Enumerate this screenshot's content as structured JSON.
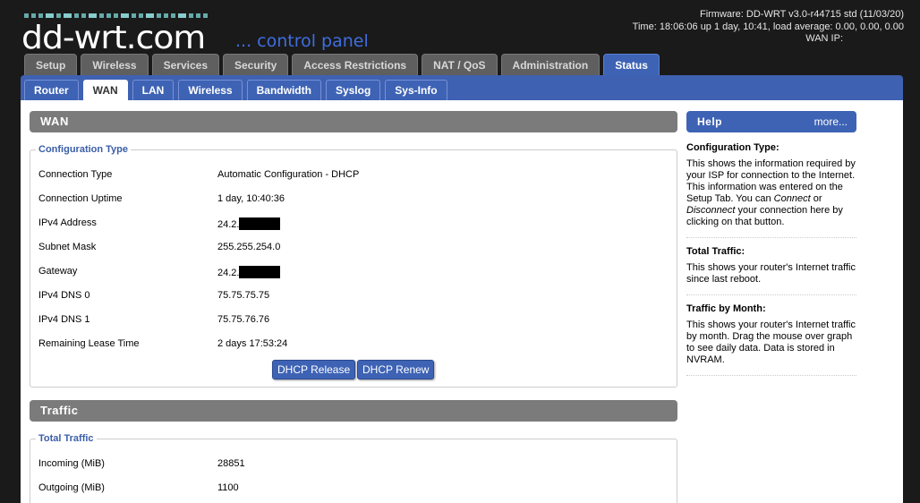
{
  "header": {
    "logo": "dd-wrt.com",
    "tagline": "... control panel",
    "firmware": "Firmware: DD-WRT v3.0-r44715 std (11/03/20)",
    "time": "Time: 18:06:06 up 1 day, 10:41, load average: 0.00, 0.00, 0.00",
    "wan_ip": "WAN IP:"
  },
  "main_tabs": [
    "Setup",
    "Wireless",
    "Services",
    "Security",
    "Access Restrictions",
    "NAT / QoS",
    "Administration",
    "Status"
  ],
  "sub_tabs": [
    "Router",
    "WAN",
    "LAN",
    "Wireless",
    "Bandwidth",
    "Syslog",
    "Sys-Info"
  ],
  "wan": {
    "title": "WAN",
    "legend": "Configuration Type",
    "rows": [
      {
        "label": "Connection Type",
        "value": "Automatic Configuration - DHCP"
      },
      {
        "label": "Connection Uptime",
        "value": "1 day, 10:40:36"
      },
      {
        "label": "IPv4 Address",
        "value": "24.2."
      },
      {
        "label": "Subnet Mask",
        "value": "255.255.254.0"
      },
      {
        "label": "Gateway",
        "value": "24.2."
      },
      {
        "label": "IPv4 DNS 0",
        "value": "75.75.75.75"
      },
      {
        "label": "IPv4 DNS 1",
        "value": "75.75.76.76"
      },
      {
        "label": "Remaining Lease Time",
        "value": "2 days 17:53:24"
      }
    ],
    "release_btn": "DHCP Release",
    "renew_btn": "DHCP Renew"
  },
  "traffic": {
    "title": "Traffic",
    "legend": "Total Traffic",
    "rows": [
      {
        "label": "Incoming (MiB)",
        "value": "28851"
      },
      {
        "label": "Outgoing (MiB)",
        "value": "1100"
      }
    ]
  },
  "help": {
    "title": "Help",
    "more": "more...",
    "items": [
      {
        "heading": "Configuration Type:",
        "text_a": "This shows the information required by your ISP for connection to the Internet. This information was entered on the Setup Tab. You can ",
        "connect": "Connect",
        "or": " or ",
        "disconnect": "Disconnect",
        "text_b": " your connection here by clicking on that button."
      },
      {
        "heading": "Total Traffic:",
        "text": "This shows your router's Internet traffic since last reboot."
      },
      {
        "heading": "Traffic by Month:",
        "text": "This shows your router's Internet traffic by month. Drag the mouse over graph to see daily data. Data is stored in NVRAM."
      }
    ]
  },
  "colors": {
    "accent": "#3e63b5",
    "section": "#7b7b7b",
    "legend": "#3a5ea8"
  }
}
